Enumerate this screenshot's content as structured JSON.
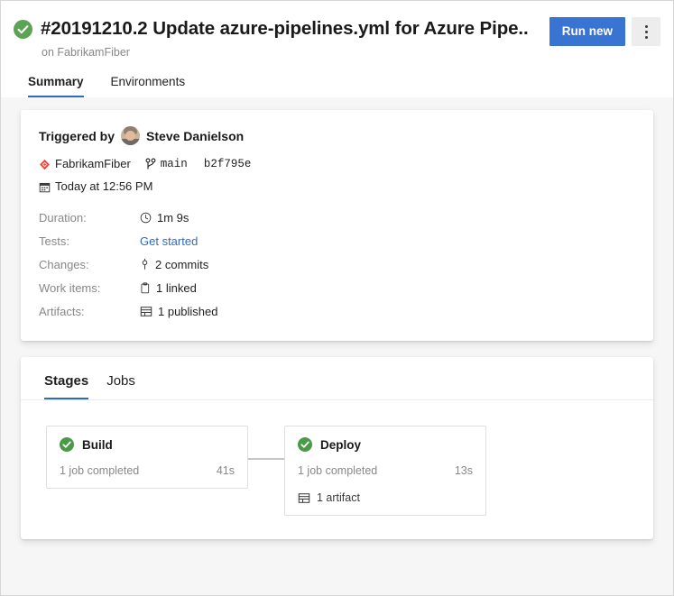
{
  "header": {
    "status_icon": "check-circle-icon",
    "status_color": "#5aa454",
    "title": "#20191210.2 Update azure-pipelines.yml for Azure Pipe...",
    "subtitle": "on FabrikamFiber",
    "run_new_label": "Run new",
    "run_new_color": "#3a74d3",
    "more_actions_icon": "more-vertical-icon"
  },
  "page_tabs": [
    {
      "label": "Summary",
      "active": true
    },
    {
      "label": "Environments",
      "active": false
    }
  ],
  "details": {
    "triggered_by_label": "Triggered by",
    "triggered_by_user": "Steve Danielson",
    "avatar_icon": "user-avatar",
    "repo_icon": "azure-repos-icon",
    "repo_name": "FabrikamFiber",
    "branch_icon": "branch-icon",
    "branch_name": "main",
    "commit_hash": "b2f795e",
    "date_icon": "calendar-icon",
    "date_text": "Today at 12:56 PM",
    "rows": [
      {
        "key": "Duration:",
        "icon": "clock-icon",
        "value": "1m 9s",
        "is_link": false
      },
      {
        "key": "Tests:",
        "icon": "",
        "value": "Get started",
        "is_link": true
      },
      {
        "key": "Changes:",
        "icon": "commit-icon",
        "value": "2 commits",
        "is_link": false
      },
      {
        "key": "Work items:",
        "icon": "work-item-icon",
        "value": "1 linked",
        "is_link": false
      },
      {
        "key": "Artifacts:",
        "icon": "artifact-icon",
        "value": "1 published",
        "is_link": false
      }
    ]
  },
  "stages_section": {
    "tabs": [
      {
        "label": "Stages",
        "active": true
      },
      {
        "label": "Jobs",
        "active": false
      }
    ],
    "stages": [
      {
        "name": "Build",
        "status_icon": "check-circle-icon",
        "jobs_text": "1 job completed",
        "duration": "41s",
        "artifact": null
      },
      {
        "name": "Deploy",
        "status_icon": "check-circle-icon",
        "jobs_text": "1 job completed",
        "duration": "13s",
        "artifact": "1 artifact",
        "artifact_icon": "artifact-icon"
      }
    ]
  },
  "colors": {
    "accent_blue": "#2b6bc4",
    "success_green": "#4a9a46",
    "repo_red": "#e8453c",
    "page_background": "#f6f6f6",
    "muted_text": "#8a8886"
  }
}
